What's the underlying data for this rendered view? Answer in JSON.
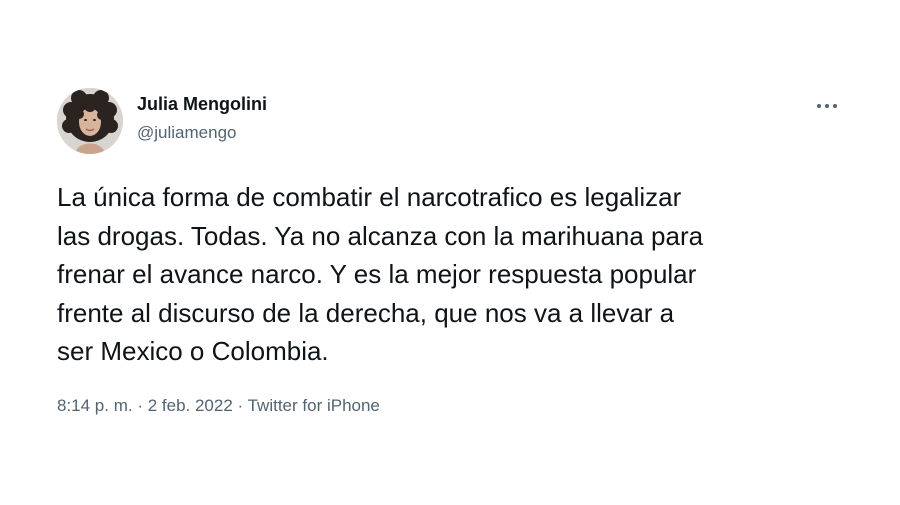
{
  "tweet": {
    "author": {
      "name": "Julia Mengolini",
      "handle": "@juliamengo",
      "avatar": "profile-photo"
    },
    "more_icon": "more-horizontal-icon",
    "text": "La única forma de combatir el narcotrafico es legalizar\nlas drogas. Todas. Ya no alcanza con la marihuana para\nfrenar el avance narco. Y es la mejor respuesta popular\nfrente al discurso de la derecha, que nos va a llevar a\nser Mexico o Colombia.",
    "time": "8:14 p. m.",
    "separator": " · ",
    "date": "2 feb. 2022",
    "source": "Twitter for iPhone"
  },
  "colors": {
    "background": "#ffffff",
    "text_primary": "#0f1419",
    "text_secondary": "#536471"
  }
}
